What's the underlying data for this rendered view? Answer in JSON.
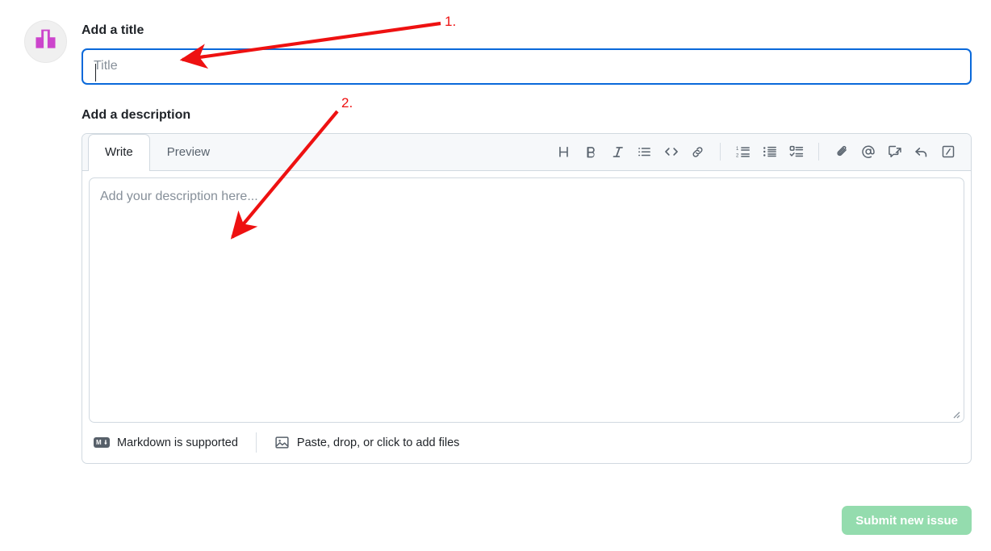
{
  "avatar": {
    "name": "user-avatar",
    "shape_color": "#cc44cc",
    "background_color": "#f0f0f0"
  },
  "form": {
    "title_label": "Add a title",
    "title_value": "",
    "title_placeholder": "Title",
    "title_focus_color": "#0a69da",
    "description_label": "Add a description",
    "description_value": "",
    "description_placeholder": "Add your description here..."
  },
  "editor": {
    "tabs": [
      {
        "label": "Write",
        "active": true
      },
      {
        "label": "Preview",
        "active": false
      }
    ],
    "toolbar": [
      {
        "group": 1,
        "icon": "heading-icon",
        "label": "H"
      },
      {
        "group": 1,
        "icon": "bold-icon",
        "label": "B"
      },
      {
        "group": 1,
        "icon": "italic-icon",
        "label": "I"
      },
      {
        "group": 1,
        "icon": "quote-icon",
        "label": "Quote"
      },
      {
        "group": 1,
        "icon": "code-icon",
        "label": "Code"
      },
      {
        "group": 1,
        "icon": "link-icon",
        "label": "Link"
      },
      {
        "group": 2,
        "icon": "ordered-list-icon",
        "label": "Numbered list"
      },
      {
        "group": 2,
        "icon": "unordered-list-icon",
        "label": "Unordered list"
      },
      {
        "group": 2,
        "icon": "task-list-icon",
        "label": "Task list"
      },
      {
        "group": 3,
        "icon": "paperclip-icon",
        "label": "Attach files"
      },
      {
        "group": 3,
        "icon": "mention-icon",
        "label": "Mention"
      },
      {
        "group": 3,
        "icon": "cross-reference-icon",
        "label": "Reference"
      },
      {
        "group": 3,
        "icon": "saved-reply-icon",
        "label": "Saved replies"
      },
      {
        "group": 3,
        "icon": "slash-command-icon",
        "label": "Slash commands"
      }
    ],
    "footer": {
      "markdown_label": "Markdown is supported",
      "markdown_icon_text": "M",
      "attach_label": "Paste, drop, or click to add files"
    }
  },
  "submit": {
    "label": "Submit new issue",
    "color": "#94dcae",
    "disabled": true
  },
  "annotations": [
    {
      "number": "1.",
      "target": "title-input"
    },
    {
      "number": "2.",
      "target": "description-textarea"
    }
  ]
}
